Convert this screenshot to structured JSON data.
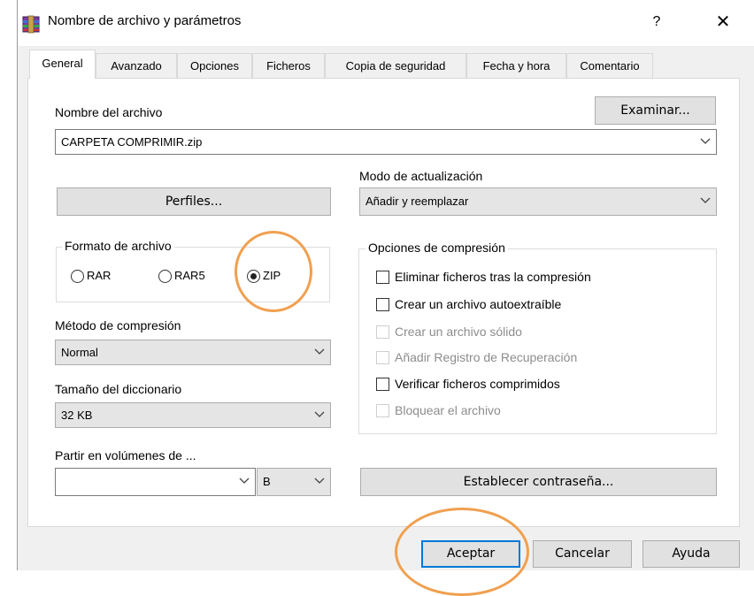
{
  "window": {
    "title": "Nombre de archivo y parámetros",
    "help_label": "?",
    "close_label": "✕"
  },
  "tabs": [
    {
      "label": "General",
      "active": true
    },
    {
      "label": "Avanzado"
    },
    {
      "label": "Opciones"
    },
    {
      "label": "Ficheros"
    },
    {
      "label": "Copia de seguridad"
    },
    {
      "label": "Fecha y hora"
    },
    {
      "label": "Comentario"
    }
  ],
  "general": {
    "filename_label": "Nombre del archivo",
    "browse_label": "Examinar...",
    "filename_value": "CARPETA COMPRIMIR.zip",
    "update_mode_label": "Modo de actualización",
    "update_mode_value": "Añadir y reemplazar",
    "profiles_label": "Perfiles...",
    "format_group_title": "Formato de archivo",
    "formats": [
      {
        "label": "RAR",
        "checked": false
      },
      {
        "label": "RAR5",
        "checked": false
      },
      {
        "label": "ZIP",
        "checked": true
      }
    ],
    "compression_method_label": "Método de compresión",
    "compression_method_value": "Normal",
    "dictionary_size_label": "Tamaño del diccionario",
    "dictionary_size_value": "32 KB",
    "split_label": "Partir en volúmenes de ...",
    "split_value": "",
    "split_unit_value": "B",
    "compression_options_title": "Opciones de compresión",
    "options": [
      {
        "label": "Eliminar ficheros tras la compresión",
        "checked": false,
        "enabled": true
      },
      {
        "label": "Crear un archivo autoextraíble",
        "checked": false,
        "enabled": true
      },
      {
        "label": "Crear un archivo sólido",
        "checked": false,
        "enabled": false
      },
      {
        "label": "Añadir Registro de Recuperación",
        "checked": false,
        "enabled": false
      },
      {
        "label": "Verificar ficheros comprimidos",
        "checked": false,
        "enabled": true
      },
      {
        "label": "Bloquear el archivo",
        "checked": false,
        "enabled": false
      }
    ],
    "password_label": "Establecer contraseña..."
  },
  "footer": {
    "ok_label": "Aceptar",
    "cancel_label": "Cancelar",
    "help_label": "Ayuda"
  },
  "colors": {
    "annotation_circle": "#f0a050",
    "focus_border": "#0078d7",
    "dialog_background": "#f0f0f0"
  },
  "icons": [
    "winrar-app-icon",
    "chevron-down-icon",
    "close-icon",
    "help-icon"
  ]
}
